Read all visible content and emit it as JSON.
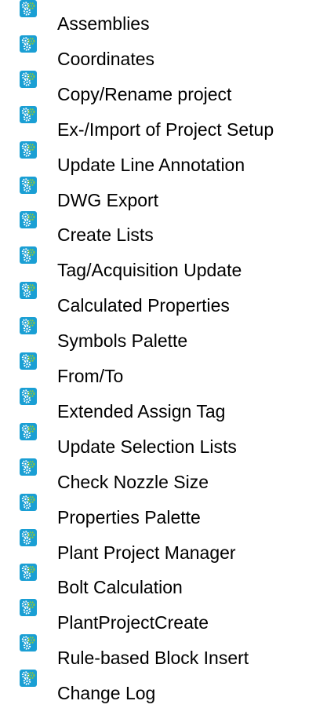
{
  "items": [
    {
      "label": "Assemblies",
      "icon": "gears-icon"
    },
    {
      "label": "Coordinates",
      "icon": "gears-icon"
    },
    {
      "label": "Copy/Rename project",
      "icon": "gears-icon"
    },
    {
      "label": "Ex-/Import of Project Setup",
      "icon": "gears-icon"
    },
    {
      "label": "Update Line Annotation",
      "icon": "gears-icon"
    },
    {
      "label": "DWG Export",
      "icon": "gears-icon"
    },
    {
      "label": "Create Lists",
      "icon": "gears-icon"
    },
    {
      "label": "Tag/Acquisition Update",
      "icon": "gears-icon"
    },
    {
      "label": "Calculated Properties",
      "icon": "gears-icon"
    },
    {
      "label": "Symbols Palette",
      "icon": "gears-icon"
    },
    {
      "label": "From/To",
      "icon": "gears-icon"
    },
    {
      "label": "Extended Assign Tag",
      "icon": "gears-icon"
    },
    {
      "label": "Update Selection Lists",
      "icon": "gears-icon"
    },
    {
      "label": "Check Nozzle Size",
      "icon": "gears-icon"
    },
    {
      "label": "Properties Palette",
      "icon": "gears-icon"
    },
    {
      "label": "Plant Project Manager",
      "icon": "gears-icon"
    },
    {
      "label": "Bolt Calculation",
      "icon": "gears-icon"
    },
    {
      "label": "PlantProjectCreate",
      "icon": "gears-icon"
    },
    {
      "label": "Rule-based Block Insert",
      "icon": "gears-icon"
    },
    {
      "label": "Change Log",
      "icon": "gears-icon"
    }
  ],
  "colors": {
    "icon_background": "#1a9fd4",
    "gear_white": "#ffffff",
    "gear_green": "#8cc63f",
    "text": "#000000"
  }
}
